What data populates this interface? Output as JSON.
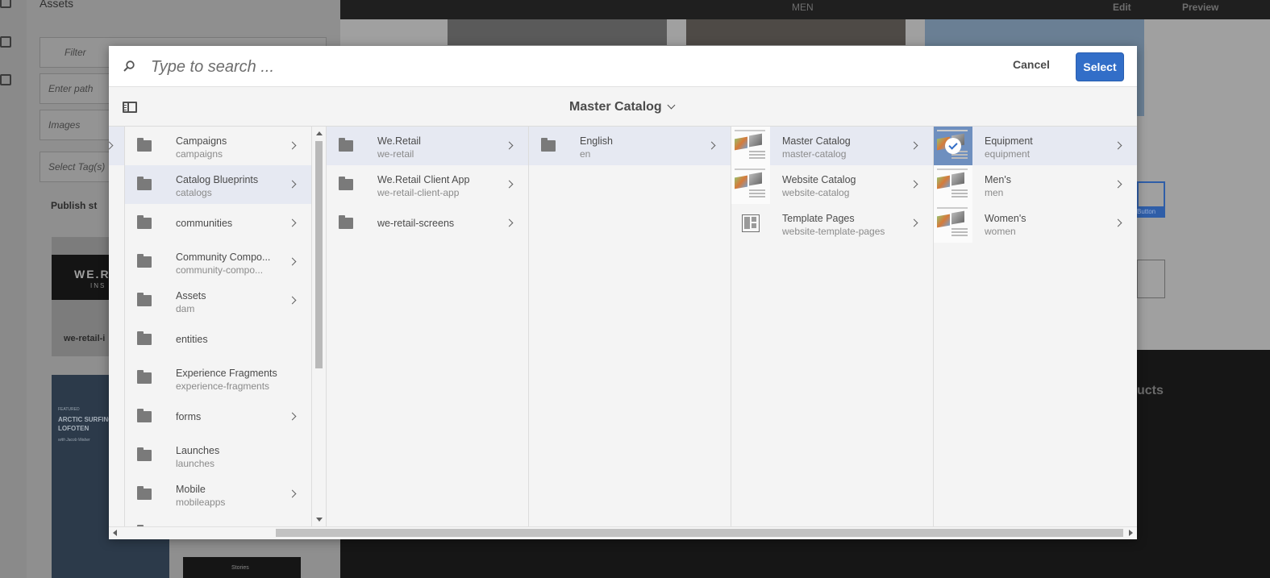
{
  "background": {
    "panel_title": "Assets",
    "filter_placeholder": "Filter",
    "path_placeholder": "Enter path",
    "type_value": "Images",
    "tags_placeholder": "Select Tag(s)",
    "publish_label": "Publish st",
    "card_label": "we-retail-i",
    "top_label": "MEN",
    "edit_label": "Edit",
    "preview_label": "Preview",
    "button_label": "Button",
    "products_label": "ucts",
    "stories_label": "Stories",
    "card_brand": "WE.R",
    "card_subtitle": "INS",
    "card2_tag": "FEATURED",
    "card2_title": "ARCTIC SURFING LOFOTEN",
    "card2_author": "with Jacob Weber"
  },
  "dialog": {
    "search_placeholder": "Type to search ...",
    "cancel_label": "Cancel",
    "select_label": "Select",
    "breadcrumb_title": "Master Catalog"
  },
  "columns": [
    {
      "items": [
        {
          "title": "Campaigns",
          "subtitle": "campaigns",
          "icon": "folder-icon",
          "has_children": true,
          "active": false
        },
        {
          "title": "Catalog Blueprints",
          "subtitle": "catalogs",
          "icon": "folder-icon",
          "has_children": true,
          "active": true
        },
        {
          "title": "communities",
          "subtitle": "",
          "icon": "folder-icon",
          "has_children": true,
          "active": false
        },
        {
          "title": "Community Compo...",
          "subtitle": "community-compo...",
          "icon": "folder-icon",
          "has_children": true,
          "active": false
        },
        {
          "title": "Assets",
          "subtitle": "dam",
          "icon": "folder-icon",
          "has_children": true,
          "active": false
        },
        {
          "title": "entities",
          "subtitle": "",
          "icon": "folder-icon",
          "has_children": false,
          "active": false
        },
        {
          "title": "Experience Fragments",
          "subtitle": "experience-fragments",
          "icon": "folder-icon",
          "has_children": false,
          "active": false
        },
        {
          "title": "forms",
          "subtitle": "",
          "icon": "folder-icon",
          "has_children": true,
          "active": false
        },
        {
          "title": "Launches",
          "subtitle": "launches",
          "icon": "folder-icon",
          "has_children": false,
          "active": false
        },
        {
          "title": "Mobile",
          "subtitle": "mobileapps",
          "icon": "folder-icon",
          "has_children": true,
          "active": false
        },
        {
          "title": "Mobile",
          "subtitle": "",
          "icon": "folder-icon",
          "has_children": false,
          "active": false
        }
      ]
    },
    {
      "items": [
        {
          "title": "We.Retail",
          "subtitle": "we-retail",
          "icon": "folder-icon",
          "has_children": true,
          "active": true
        },
        {
          "title": "We.Retail Client App",
          "subtitle": "we-retail-client-app",
          "icon": "folder-icon",
          "has_children": true,
          "active": false
        },
        {
          "title": "we-retail-screens",
          "subtitle": "",
          "icon": "folder-icon",
          "has_children": true,
          "active": false
        }
      ]
    },
    {
      "items": [
        {
          "title": "English",
          "subtitle": "en",
          "icon": "folder-icon",
          "has_children": true,
          "active": true
        }
      ]
    },
    {
      "items": [
        {
          "title": "Master Catalog",
          "subtitle": "master-catalog",
          "icon": "catalog-thumbnail",
          "has_children": true,
          "active": true
        },
        {
          "title": "Website Catalog",
          "subtitle": "website-catalog",
          "icon": "catalog-thumbnail",
          "has_children": true,
          "active": false
        },
        {
          "title": "Template Pages",
          "subtitle": "website-template-pages",
          "icon": "page-icon",
          "has_children": true,
          "active": false
        }
      ]
    },
    {
      "items": [
        {
          "title": "Equipment",
          "subtitle": "equipment",
          "icon": "catalog-thumbnail-selected",
          "has_children": true,
          "active": true
        },
        {
          "title": "Men's",
          "subtitle": "men",
          "icon": "catalog-thumbnail",
          "has_children": true,
          "active": false
        },
        {
          "title": "Women's",
          "subtitle": "women",
          "icon": "catalog-thumbnail",
          "has_children": true,
          "active": false
        }
      ]
    }
  ],
  "colors": {
    "accent": "#326ec8",
    "active_row": "#e6e9f2",
    "dialog_bg": "#f4f4f4"
  }
}
